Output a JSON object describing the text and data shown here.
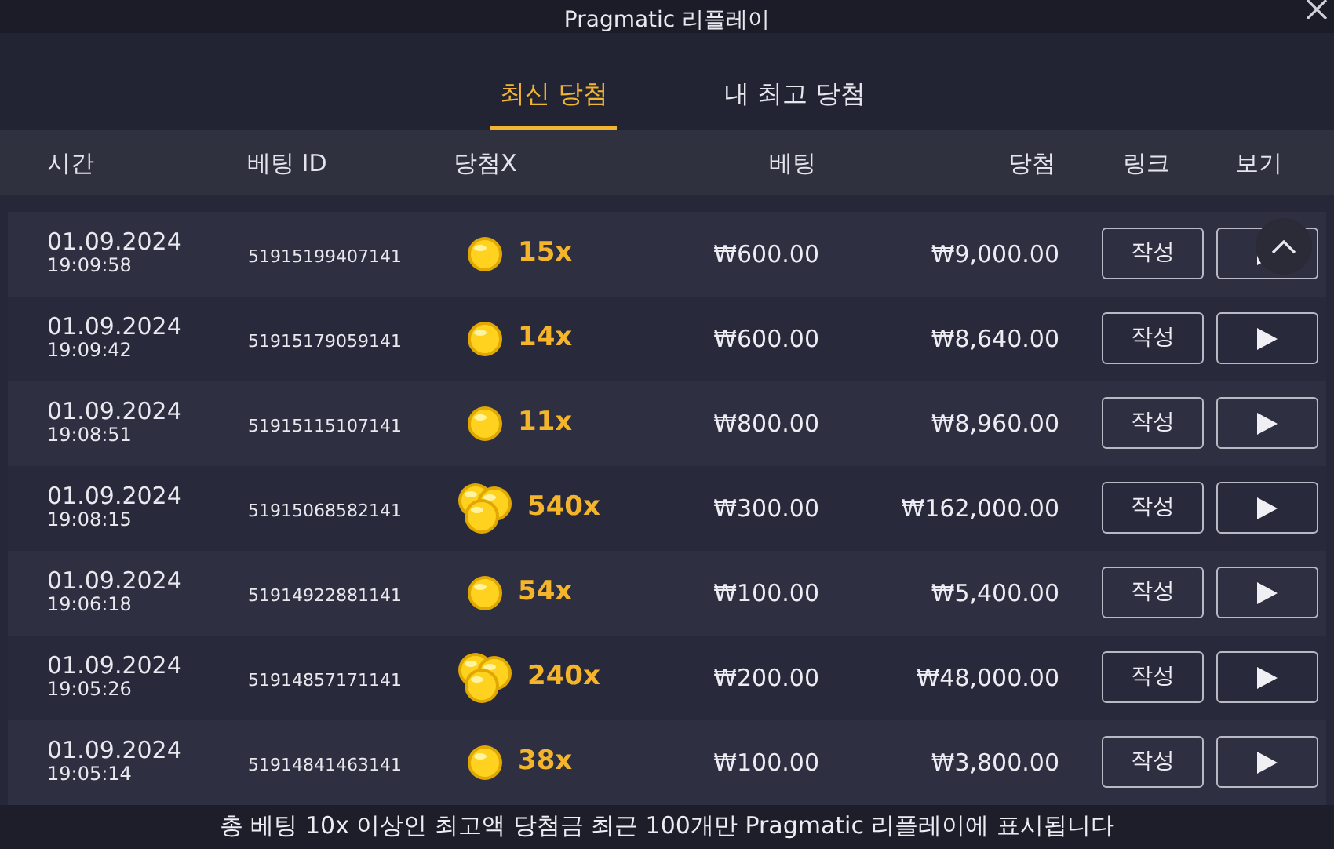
{
  "window": {
    "title": "Pragmatic 리플레이"
  },
  "tabs": [
    {
      "label": "최신 당첨",
      "selected": true
    },
    {
      "label": "내 최고 당첨",
      "selected": false
    }
  ],
  "table": {
    "columns": [
      "시간",
      "베팅 ID",
      "당첨X",
      "베팅",
      "당첨",
      "링크",
      "보기"
    ],
    "rows": [
      {
        "date": "01.09.2024",
        "time": "19:09:58",
        "bet_id": "51915199407141",
        "kind": "single",
        "multiplier": "15x",
        "bet": "₩600.00",
        "win": "₩9,000.00",
        "link": "작성"
      },
      {
        "date": "01.09.2024",
        "time": "19:09:42",
        "bet_id": "51915179059141",
        "kind": "single",
        "multiplier": "14x",
        "bet": "₩600.00",
        "win": "₩8,640.00",
        "link": "작성"
      },
      {
        "date": "01.09.2024",
        "time": "19:08:51",
        "bet_id": "51915115107141",
        "kind": "single",
        "multiplier": "11x",
        "bet": "₩800.00",
        "win": "₩8,960.00",
        "link": "작성"
      },
      {
        "date": "01.09.2024",
        "time": "19:08:15",
        "bet_id": "51915068582141",
        "kind": "pile",
        "multiplier": "540x",
        "bet": "₩300.00",
        "win": "₩162,000.00",
        "link": "작성"
      },
      {
        "date": "01.09.2024",
        "time": "19:06:18",
        "bet_id": "51914922881141",
        "kind": "single",
        "multiplier": "54x",
        "bet": "₩100.00",
        "win": "₩5,400.00",
        "link": "작성"
      },
      {
        "date": "01.09.2024",
        "time": "19:05:26",
        "bet_id": "51914857171141",
        "kind": "pile",
        "multiplier": "240x",
        "bet": "₩200.00",
        "win": "₩48,000.00",
        "link": "작성"
      },
      {
        "date": "01.09.2024",
        "time": "19:05:14",
        "bet_id": "51914841463141",
        "kind": "single",
        "multiplier": "38x",
        "bet": "₩100.00",
        "win": "₩3,800.00",
        "link": "작성"
      }
    ]
  },
  "footer": "총 베팅 10x 이상인 최고액 당첨금 최근 100개만 Pragmatic 리플레이에 표시됩니다"
}
